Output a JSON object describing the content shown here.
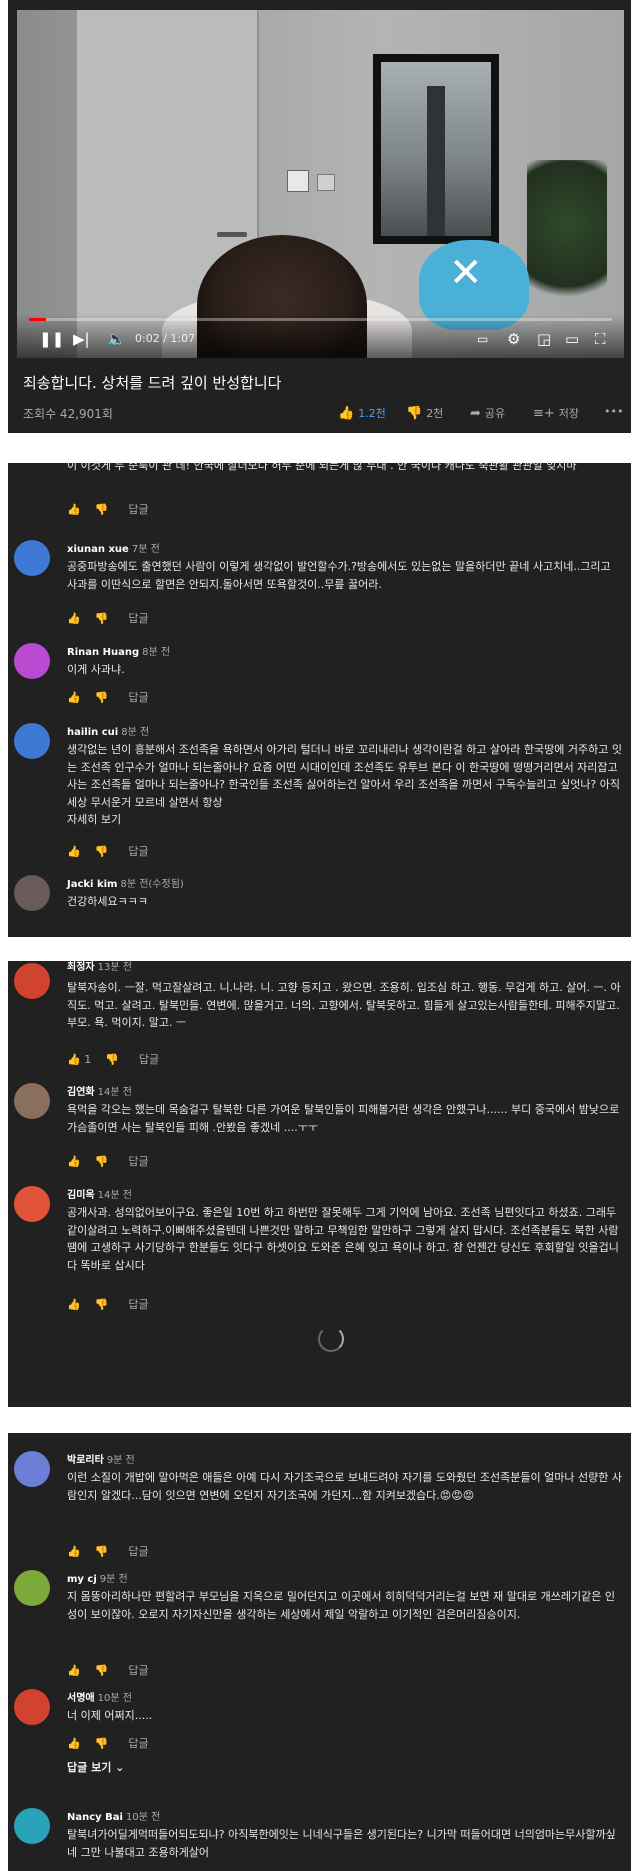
{
  "video": {
    "time": "0:02 / 1:07",
    "progress": 0.03,
    "title": "죄송합니다. 상처를 드려 깊이 반성합니다",
    "views": "조회수 42,901회",
    "like_count": "1.2천",
    "dislike_count": "2천",
    "share_label": "공유",
    "save_label": "저장",
    "more_label": "•••",
    "icons": [
      "play-pause-icon",
      "next-icon",
      "volume-icon",
      "subtitles-icon",
      "settings-icon",
      "miniplayer-icon",
      "theater-icon",
      "fullscreen-icon",
      "like-icon",
      "dislike-icon",
      "share-icon",
      "save-icon",
      "more-icon"
    ]
  },
  "labels": {
    "reply": "답글",
    "show_replies": "답글 보기",
    "loading": "loading-spinner"
  },
  "colors": {
    "bg": "#212121",
    "accent_like": "#3ea6ff",
    "progress": "#ff0000"
  },
  "panel2": [
    {
      "text": "이 이것게 두 순룩이 관 데! 안국에 살더모다 허두 준에 되는게 많 두대 . 안 국이나 캐나도 죽관활 관관일 잊지마",
      "likes": ""
    },
    {
      "name": "xiunan xue",
      "time": "7분 전",
      "avatar": "#3f79d6",
      "text": "공중파방송에도 출연했던 사람이 이렇게 생각없이 발언할수가.?방송에서도 있는없는 말을하더만 끝네 사고치네..그리고 사과를 이딴식으로 할면은 안되지.돌아서면 또욕할것이..무릎 꿇어라.",
      "likes": ""
    },
    {
      "name": "Rinan Huang",
      "time": "8분 전",
      "avatar": "#b94bd3",
      "text": "이게 사과냐.",
      "likes": ""
    },
    {
      "name": "hailin cui",
      "time": "8분 전",
      "avatar": "#3f79d6",
      "text": "생각없는 년이 흥분해서 조선족을 욕하면서 아가리 털더니 바로 꼬리내리나 생각이란걸 하고 살아라 한국땅에 거주하고 잇는 조선족 인구수가 얼마나 되는줄아나? 요즘 어떤 시대이인데 조선족도 유투브 본다 이 한국땅에 떵떵거리면서 자리잡고 사는 조선족들 얼마나 되는줄아나? 한국인들 조선족 싫어하는건 알아서 우리 조선족을 까면서 구독수늘리고 싶엇나? 아직 세상 무서운거 모르네 살면서 항상",
      "more": "자세히 보기",
      "likes": ""
    },
    {
      "name": "Jacki kim",
      "time": "8분 전(수정됨)",
      "avatar": "#6a5a5a",
      "text": "건강하세요ㅋㅋㅋ",
      "likes": ""
    }
  ],
  "panel3": [
    {
      "name": "최정자",
      "time": "13분 전",
      "avatar": "#d1432f",
      "text": "탈북자송이. ㅡ잘. 먹고잘살려고. 니.나라. 니. 고향 등지고 . 왔으면. 조용히. 입조심 하고. 행동. 무겁게 하고. 살어. ㅡ. 아직도. 먹고. 살려고. 탈북민들. 연변에. 많을거고. 너의. 고향에서. 탈북못하고. 힘들게 살고있는사람들한테. 피해주지말고. 부모. 욕. 먹이지. 말고. ㅡ",
      "likes": "1"
    },
    {
      "name": "김연화",
      "time": "14분 전",
      "avatar": "#8a6f5e",
      "text": "욕먹을 각오는 했는데 목숨걸구 탈북한 다른 가여운 탈북인들이 피해볼거란 생각은 안했구나...... 부디 중국에서 밤낮으로 가슴졸이면 사는 탈북인들 피해 .안봤음 좋겠네 ....ㅜㅜ",
      "likes": ""
    },
    {
      "name": "김미옥",
      "time": "14분 전",
      "avatar": "#e2543a",
      "text": "공개사과. 성의없어보이구요. 좋은일 10번 하고 하번만 잘못해두 그게 기억에 남아요. 조선족 님편잇다고 하셨죠. 그래두 같이살려고 노력하구.이뻐해주셨을텐데 나쁜것만 말하고 무책임한 말만하구 그렇게 살지 맙시다. 조선족분들도 북한 사람땜에 고생하구 사기당하구 한분들도 잇다구 하셋이요 도와준 은혜 잊고 욕이나 하고. 참 언젠간 당신도 후회할일 잇을겁니다 똑바로 삽시다",
      "likes": ""
    }
  ],
  "panel4": [
    {
      "name": "박로리타",
      "time": "9분 전",
      "avatar": "#6b7fd7",
      "text": "이런 소질이 개밥에 말아먹은 애들은 아예 다시 자기조국으로 보내드려야 자기를 도와줬던 조선족분들이 얼마나 선량한 사람인지 알겠다...담이 잇으면 연변에 오던지 자기조국에 가던지...함 지켜보겠습다.😡😡😡",
      "likes": ""
    },
    {
      "name": "my cj",
      "time": "9분 전",
      "avatar": "#7cab3c",
      "text": "지 몸뚱아리하나만 편할려구 부모님을 지옥으로 밀어던지고 이곳에서 히히덕덕거리는걸 보면 재 말대로 개쓰레기같은 인성이 보이잖아. 오로지 자기자신만을 생각하는 세상에서 제일 악랄하고 이기적인 검은머리짐승이지.",
      "likes": ""
    },
    {
      "name": "서명애",
      "time": "10분 전",
      "avatar": "#d1432f",
      "text": "너 이제 어쩌지.....",
      "likes": ""
    },
    {
      "name": "Nancy Bai",
      "time": "10분 전",
      "avatar": "#29a3b8",
      "text": "탈북녀가어딜게먹떠들어되도되냐? 아직북한에잇는 니네식구들은 생기된다는? 니가막 떠들어대면 너의엄마는무사할까싶네 그만 나불대고 조용하게살어",
      "likes": ""
    }
  ]
}
